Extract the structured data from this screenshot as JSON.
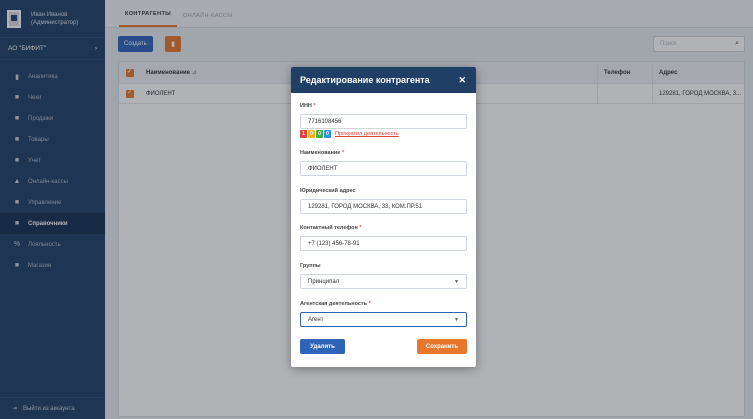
{
  "sidebar": {
    "user_name": "Иван Иванов",
    "user_role": "(Администратор)",
    "org_name": "АО \"БИФИТ\"",
    "items": [
      {
        "label": "Аналитика",
        "icon": "chart-icon"
      },
      {
        "label": "Чеки",
        "icon": "receipt-icon"
      },
      {
        "label": "Продажи",
        "icon": "sales-icon"
      },
      {
        "label": "Товары",
        "icon": "goods-icon"
      },
      {
        "label": "Учет",
        "icon": "accounting-icon"
      },
      {
        "label": "Онлайн-кассы",
        "icon": "cashbox-icon"
      },
      {
        "label": "Управление",
        "icon": "management-icon"
      },
      {
        "label": "Справочники",
        "icon": "reference-icon",
        "active": true
      },
      {
        "label": "Лояльность",
        "icon": "percent-icon"
      },
      {
        "label": "Магазин",
        "icon": "shop-icon"
      }
    ],
    "logout_label": "Выйти из аккаунта"
  },
  "tabs": [
    "КОНТРАГЕНТЫ",
    "ОНЛАЙН-КАССЫ"
  ],
  "toolbar": {
    "create_label": "Создать",
    "search_placeholder": "Поиск"
  },
  "table": {
    "headers": {
      "name": "Наименование",
      "phone": "Телефон",
      "address": "Адрес"
    },
    "rows": [
      {
        "name": "ФИОЛЕНТ",
        "phone": "",
        "address": "129281, ГОРОД МОСКВА, 3..."
      }
    ]
  },
  "modal": {
    "title": "Редактирование контрагента",
    "inn_label": "ИНН",
    "inn_value": "7716108456",
    "chips": [
      "1",
      "0",
      "0",
      "0"
    ],
    "stop_link": "Прекратил деятельность",
    "name_label": "Наименование",
    "name_value": "ФИОЛЕНТ",
    "address_label": "Юридический адрес",
    "address_value": "129281, ГОРОД МОСКВА, 33, КОМ.ПР.51",
    "phone_label": "Контактный телефон",
    "phone_value": "+7 (123) 456-78-91",
    "groups_label": "Группы",
    "groups_value": "Принципал",
    "agent_label": "Агентская деятельность",
    "agent_value": "Агент",
    "delete_label": "Удалить",
    "save_label": "Сохранить"
  },
  "colors": {
    "sidebar": "#1f3f67",
    "primary": "#2f63b8",
    "accent": "#e8772e",
    "required": "#e0443a"
  }
}
